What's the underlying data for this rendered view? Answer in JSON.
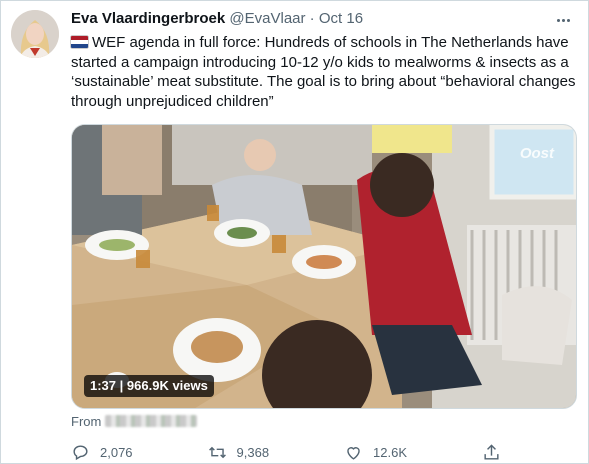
{
  "tweet": {
    "author_name": "Eva Vlaardingerbroek",
    "handle": "@EvaVlaar",
    "separator": "·",
    "date": "Oct 16",
    "text": "WEF agenda in full force: Hundreds of schools in The Netherlands have started a campaign introducing 10-12 y/o kids to mealworms & insects as a ‘sustainable’ meat substitute. The goal is to bring about “behavioral changes through unprejudiced children”"
  },
  "media": {
    "duration": "1:37",
    "views": "966.9K views",
    "watermark": "Oost"
  },
  "source": {
    "label": "From"
  },
  "actions": {
    "replies": "2,076",
    "retweets": "9,368",
    "likes": "12.6K"
  },
  "icons": {
    "flag": "netherlands-flag-icon",
    "more": "more-icon",
    "reply": "reply-icon",
    "retweet": "retweet-icon",
    "like": "heart-icon",
    "share": "share-icon"
  },
  "colors": {
    "text": "#0f1419",
    "secondary": "#536471",
    "border": "#cfd9de"
  }
}
